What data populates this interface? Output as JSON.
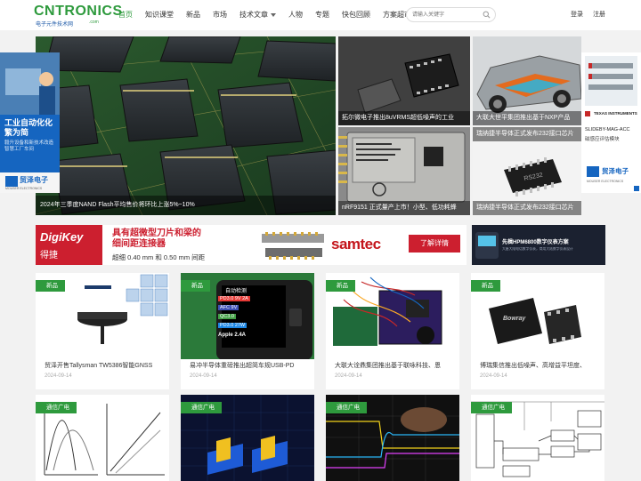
{
  "header": {
    "logo_text": "CNTRONICS",
    "logo_sub": "电子元件技术网",
    "logo_domain": ".com",
    "nav": [
      {
        "label": "首页",
        "active": true
      },
      {
        "label": "知识课堂"
      },
      {
        "label": "新品"
      },
      {
        "label": "市场"
      },
      {
        "label": "技术文章",
        "dropdown": true
      },
      {
        "label": "人物"
      },
      {
        "label": "专题"
      },
      {
        "label": "快包回顾"
      },
      {
        "label": "方案超市"
      }
    ],
    "search_placeholder": "请输入关键字",
    "login": "登录",
    "register": "注册"
  },
  "hero": {
    "caption": "2024年三季度NAND Flash平均售价将环比上涨5%~10%"
  },
  "tiles": [
    {
      "caption": "拓尔微电子推出8uVRMS超低噪声的工业"
    },
    {
      "caption": "大联大世平集团推出基于NXP产品"
    },
    {
      "caption": "nRF9151 正式量产上市！小型、低功耗蜂"
    },
    {
      "caption": "瑞纳捷半导体正式发布232接口芯片",
      "overlay_caption": "瑞纳捷半导体正式发布232接口芯片"
    }
  ],
  "tile_chip_text": {
    "nrf": "nRF9151",
    "rs232": "RS232"
  },
  "left_ad": {
    "headline": "工业自动化化繁为简",
    "subline": "毅升设备和新技术改造智慧工厂车间",
    "brand": "贸泽电子",
    "brand_en": "MOUSER ELECTRONICS"
  },
  "right_ad": {
    "brand_ti": "TEXAS INSTRUMENTS",
    "product": "SLIDEBY-MAG-ACC",
    "desc": "磁感应评估模块",
    "brand": "贸泽电子",
    "brand_en": "MOUSER ELECTRONICS"
  },
  "banner_main": {
    "brand": "DigiKey",
    "brand_cn": "得捷",
    "headline_line1": "具有超微型刀片和梁的",
    "headline_line2": "细间距连接器",
    "spec": "超细 0.40 mm 和 0.50 mm 间距",
    "partner": "samtec",
    "cta": "了解详情"
  },
  "banner_side": {
    "title": "先楫HPM6800数字仪表方案",
    "sub": "大唐大陆电话数字仪表，商用大陆数字仪表设计"
  },
  "cards_row1": [
    {
      "tag": "新品",
      "title": "贸泽开售Tallysman TW5386智能GNSS",
      "date": "2024-09-14"
    },
    {
      "tag": "新品",
      "title": "易冲半导体重磅推出超简车规USB-PD",
      "date": "2024-09-14",
      "screen": [
        "自动检测",
        "PD3.0 9V 2A",
        "AFC 9V",
        "QC3.0",
        "PD3.0 27W",
        "Apple 2.4A"
      ]
    },
    {
      "tag": "新品",
      "title": "大联大诠鼎集团推出基于联咏科技、恩",
      "date": "2024-09-14"
    },
    {
      "tag": "新品",
      "title": "博瑞集信推出低噪声、高增益平坦度、",
      "date": "2024-09-14",
      "chip_brand": "Bowray"
    }
  ],
  "cards_row2": [
    {
      "tag": "通信广电"
    },
    {
      "tag": "通信广电"
    },
    {
      "tag": "通信广电"
    },
    {
      "tag": "通信广电"
    }
  ],
  "colors": {
    "brand_green": "#2e9a3d",
    "tag_green": "#2e9a3d",
    "digikey_red": "#cc1f2f",
    "samtec_red": "#c4161c",
    "mouser_blue": "#1565c0"
  }
}
